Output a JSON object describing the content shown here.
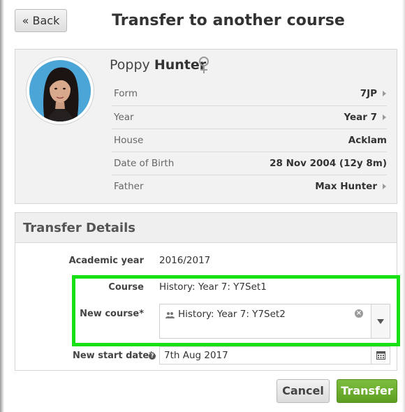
{
  "header": {
    "back_label": "« Back",
    "title": "Transfer to another course"
  },
  "student": {
    "first_name": "Poppy",
    "last_name": "Hunter",
    "gender_icon": "female-icon",
    "info": [
      {
        "label": "Form",
        "value": "7JP",
        "link": true
      },
      {
        "label": "Year",
        "value": "Year 7",
        "link": true
      },
      {
        "label": "House",
        "value": "Acklam",
        "link": false
      },
      {
        "label": "Date of Birth",
        "value": "28 Nov 2004 (12y 8m)",
        "link": false
      },
      {
        "label": "Father",
        "value": "Max Hunter",
        "link": true
      }
    ]
  },
  "transfer": {
    "title": "Transfer Details",
    "academic_year_label": "Academic year",
    "academic_year_value": "2016/2017",
    "course_label": "Course",
    "course_value": "History: Year 7: Y7Set1",
    "new_course_label": "New course*",
    "new_course_value": "History: Year 7: Y7Set2",
    "new_start_date_label": "New start date*",
    "new_start_date_value": "7th Aug 2017"
  },
  "footer": {
    "cancel_label": "Cancel",
    "transfer_label": "Transfer"
  },
  "colors": {
    "highlight": "#17e015",
    "transfer_button": "#6aaa2d"
  }
}
